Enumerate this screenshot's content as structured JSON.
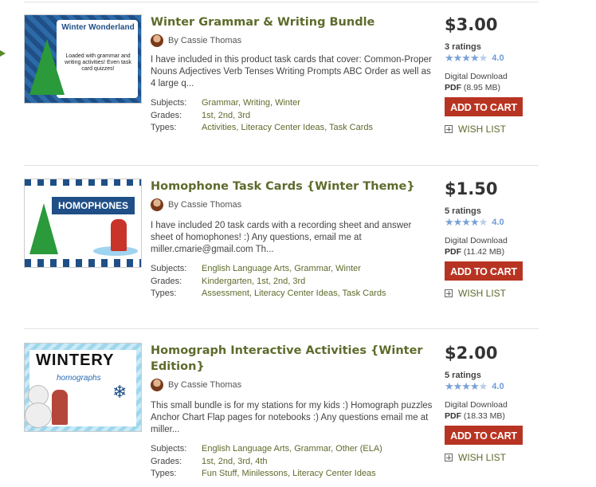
{
  "products": [
    {
      "title": "Winter Grammar & Writing Bundle",
      "author_prefix": "By",
      "author": "Cassie Thomas",
      "description": "I have included in this product task cards that cover: Common-Proper Nouns Adjectives Verb Tenses Writing Prompts ABC Order as well as 4 large q...",
      "subjects_label": "Subjects:",
      "subjects": "Grammar, Writing, Winter",
      "grades_label": "Grades:",
      "grades": "1st, 2nd, 3rd",
      "types_label": "Types:",
      "types": "Activities, Literacy Center Ideas, Task Cards",
      "price": "$3.00",
      "ratings_count": "3 ratings",
      "rating": "4.0",
      "download_label": "Digital Download",
      "format": "PDF",
      "size": "(8.95 MB)",
      "cart_label": "ADD TO CART",
      "wish_label": "WISH LIST",
      "thumb_title": "Winter Wonderland",
      "thumb_sub": "Loaded with grammar and writing activities! Even task card quizzes!"
    },
    {
      "title": "Homophone Task Cards {Winter Theme}",
      "author_prefix": "By",
      "author": "Cassie Thomas",
      "description": "I have included 20 task cards with a recording sheet and answer sheet of homophones! :) Any questions, email me at miller.cmarie@gmail.com Th...",
      "subjects_label": "Subjects:",
      "subjects": "English Language Arts, Grammar, Winter",
      "grades_label": "Grades:",
      "grades": "Kindergarten, 1st, 2nd, 3rd",
      "types_label": "Types:",
      "types": "Assessment, Literacy Center Ideas, Task Cards",
      "price": "$1.50",
      "ratings_count": "5 ratings",
      "rating": "4.0",
      "download_label": "Digital Download",
      "format": "PDF",
      "size": "(11.42 MB)",
      "cart_label": "ADD TO CART",
      "wish_label": "WISH LIST",
      "thumb_title": "HOMOPHONES"
    },
    {
      "title": "Homograph Interactive Activities {Winter Edition}",
      "author_prefix": "By",
      "author": "Cassie Thomas",
      "description": "This small bundle is for my stations for my kids :) Homograph puzzles Anchor Chart Flap pages for notebooks :) Any questions email me at miller...",
      "subjects_label": "Subjects:",
      "subjects": "English Language Arts, Grammar, Other (ELA)",
      "grades_label": "Grades:",
      "grades": "1st, 2nd, 3rd, 4th",
      "types_label": "Types:",
      "types": "Fun Stuff, Minilessons, Literacy Center Ideas",
      "price": "$2.00",
      "ratings_count": "5 ratings",
      "rating": "4.0",
      "download_label": "Digital Download",
      "format": "PDF",
      "size": "(18.33 MB)",
      "cart_label": "ADD TO CART",
      "wish_label": "WISH LIST",
      "thumb_title": "WINTERY",
      "thumb_sub": "homographs"
    }
  ],
  "colors": {
    "title": "#5d6b2b",
    "cart": "#b83422",
    "star": "#7aa2d8"
  }
}
